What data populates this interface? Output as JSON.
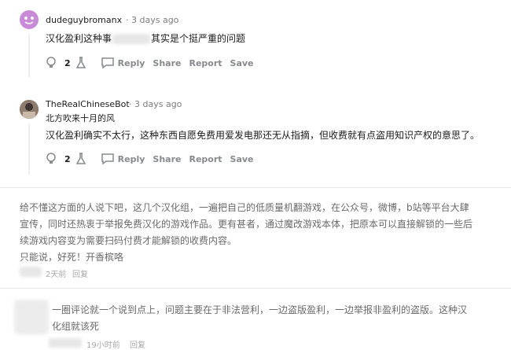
{
  "comments": [
    {
      "username": "dudeguybromanx",
      "time": "3 days ago",
      "text_before": "汉化盈利这种事",
      "text_after": "其实是个挺严重的问题",
      "votes": "2",
      "actions": [
        "Reply",
        "Share",
        "Report",
        "Save"
      ]
    },
    {
      "username": "TheRealChineseBot",
      "time": "3 days ago",
      "line1": "北方吹来十月的风",
      "line2": "汉化盈利确实不太行，这种东西自愿免费用爱发电那还无从指摘，但收费就有点盗用知识产权的意思了。",
      "votes": "2",
      "actions": [
        "Reply",
        "Share",
        "Report",
        "Save"
      ]
    }
  ],
  "post1": {
    "lines": [
      "给不懂这方面的人说下吧，这几个汉化组，一遍把自己的低质量机翻游戏，在公众号，微博，b站等平台大肆",
      "宣传，同时还热衷于举报免费汉化的游戏作品。更有甚者，通过魔改游戏本体，把原本可以直接解锁的一些后",
      "续游戏内容变为需要扫码付费才能解锁的收费内容。",
      "只能说，好死！开香槟咯"
    ],
    "time": "2天前",
    "reply": "回复"
  },
  "post2": {
    "lines": [
      "一圈评论就一个说到点上，问题主要在于非法营利，一边盗版盈利，一边举报非盈利的盗版。这种汉",
      "化组就该死"
    ],
    "time": "19小时前",
    "reply": "回复"
  },
  "colors": {
    "avatar1": "#c98bd8",
    "action_grey": "#878a8c"
  }
}
